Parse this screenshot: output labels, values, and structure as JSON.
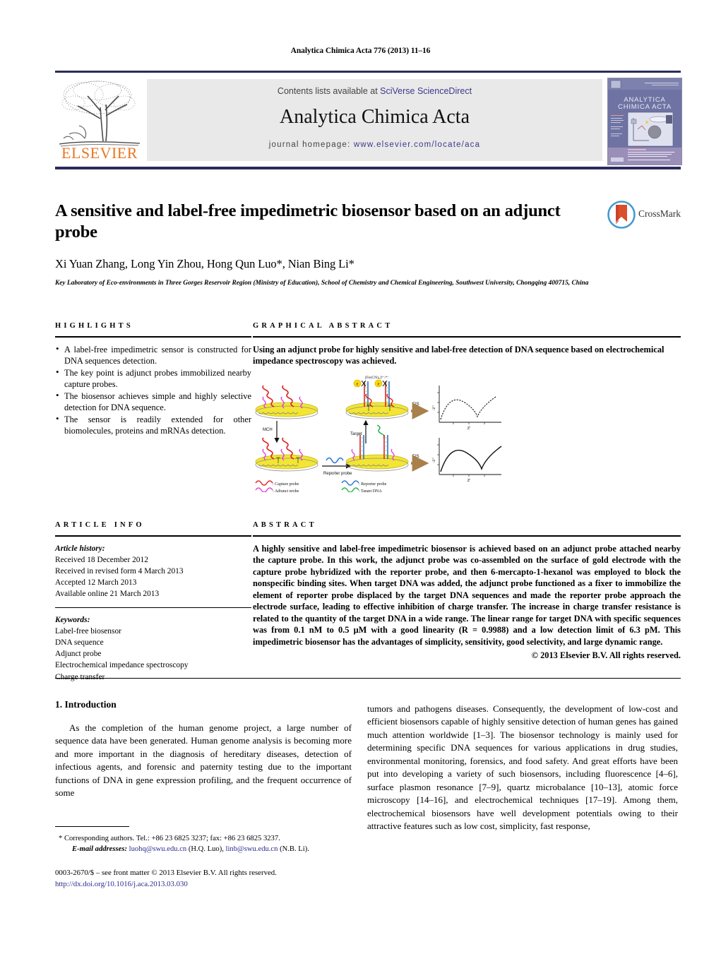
{
  "running_head": "Analytica Chimica Acta 776 (2013) 11–16",
  "masthead": {
    "contents_prefix": "Contents lists available at ",
    "contents_link": "SciVerse ScienceDirect",
    "journal_title": "Analytica Chimica Acta",
    "homepage_prefix": "journal homepage: ",
    "homepage_url": "www.elsevier.com/locate/aca",
    "publisher_wordmark": "ELSEVIER",
    "publisher_color": "#e87722",
    "link_color": "#3a3a8c",
    "rule_color": "#2b2b5e",
    "cover_title_line1": "ANALYTICA",
    "cover_title_line2": "CHIMICA ACTA"
  },
  "title_block": {
    "title": "A sensitive and label-free impedimetric biosensor based on an adjunct probe",
    "authors": "Xi Yuan Zhang, Long Yin Zhou, Hong Qun Luo*, Nian Bing Li*",
    "affiliation": "Key Laboratory of Eco-environments in Three Gorges Reservoir Region (Ministry of Education), School of Chemistry and Chemical Engineering, Southwest University, Chongqing 400715, China",
    "crossmark_label": "CrossMark"
  },
  "highlights": {
    "heading": "HIGHLIGHTS",
    "items": [
      "A label-free impedimetric sensor is constructed for DNA sequences detection.",
      "The key point is adjunct probes immobilized nearby capture probes.",
      "The biosensor achieves simple and highly selective detection for DNA sequence.",
      "The sensor is readily extended for other biomolecules, proteins and mRNAs detection."
    ]
  },
  "graphical_abstract": {
    "heading": "GRAPHICAL ABSTRACT",
    "text": "Using an adjunct probe for highly sensitive and label-free detection of DNA sequence based on electrochemical impedance spectroscopy was achieved.",
    "figure": {
      "redox_label": "[Fe(CN)₆]³⁻/⁴⁻",
      "electron_label": "e",
      "step_labels": [
        "MCH",
        "Reporter probe",
        "Target",
        "EIS"
      ],
      "plot_x_axis": "Z'",
      "plot_y_axis": "-Z\"",
      "legend": [
        {
          "label": "Capture probe",
          "color": "#e02020"
        },
        {
          "label": "Reporter probe",
          "color": "#2b6fd6"
        },
        {
          "label": "Adjunct probe",
          "color": "#e040e0"
        },
        {
          "label": "Target DNA",
          "color": "#22b14c"
        }
      ],
      "electrode_color": "#f2e534"
    }
  },
  "article_info": {
    "heading": "ARTICLE INFO",
    "history_label": "Article history:",
    "history": [
      "Received 18 December 2012",
      "Received in revised form 4 March 2013",
      "Accepted 12 March 2013",
      "Available online 21 March 2013"
    ],
    "keywords_label": "Keywords:",
    "keywords": [
      "Label-free biosensor",
      "DNA sequence",
      "Adjunct probe",
      "Electrochemical impedance spectroscopy",
      "Charge transfer"
    ]
  },
  "abstract": {
    "heading": "ABSTRACT",
    "text": "A highly sensitive and label-free impedimetric biosensor is achieved based on an adjunct probe attached nearby the capture probe. In this work, the adjunct probe was co-assembled on the surface of gold electrode with the capture probe hybridized with the reporter probe, and then 6-mercapto-1-hexanol was employed to block the nonspecific binding sites. When target DNA was added, the adjunct probe functioned as a fixer to immobilize the element of reporter probe displaced by the target DNA sequences and made the reporter probe approach the electrode surface, leading to effective inhibition of charge transfer. The increase in charge transfer resistance is related to the quantity of the target DNA in a wide range. The linear range for target DNA with specific sequences was from 0.1 nM to 0.5 μM with a good linearity (R = 0.9988) and a low detection limit of 6.3 pM. This impedimetric biosensor has the advantages of simplicity, sensitivity, good selectivity, and large dynamic range.",
    "copyright": "© 2013 Elsevier B.V. All rights reserved."
  },
  "body": {
    "section_number_title": "1.  Introduction",
    "left_paragraph": "As the completion of the human genome project, a large number of sequence data have been generated. Human genome analysis is becoming more and more important in the diagnosis of hereditary diseases, detection of infectious agents, and forensic and paternity testing due to the important functions of DNA in gene expression profiling, and the frequent occurrence of some",
    "right_paragraph": "tumors and pathogens diseases. Consequently, the development of low-cost and efficient biosensors capable of highly sensitive detection of human genes has gained much attention worldwide [1–3]. The biosensor technology is mainly used for determining specific DNA sequences for various applications in drug studies, environmental monitoring, forensics, and food safety. And great efforts have been put into developing a variety of such biosensors, including fluorescence [4–6], surface plasmon resonance [7–9], quartz microbalance [10–13], atomic force microscopy [14–16], and electrochemical techniques [17–19]. Among them, electrochemical biosensors have well development potentials owing to their attractive features such as low cost, simplicity, fast response,"
  },
  "footnotes": {
    "corresponding": "* Corresponding authors. Tel.: +86 23 6825 3237; fax: +86 23 6825 3237.",
    "email_label": "E-mail addresses:",
    "email1": "luohq@swu.edu.cn",
    "email1_owner": "(H.Q. Luo),",
    "email2": "linb@swu.edu.cn",
    "email2_owner": "(N.B. Li).",
    "imprint": "0003-2670/$ – see front matter © 2013 Elsevier B.V. All rights reserved.",
    "doi": "http://dx.doi.org/10.1016/j.aca.2013.03.030"
  }
}
